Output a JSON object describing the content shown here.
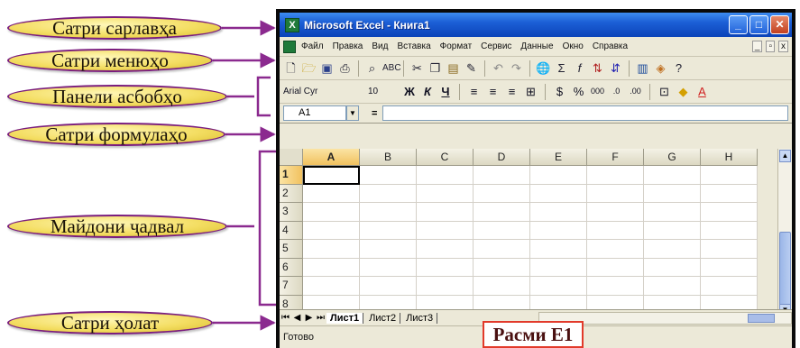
{
  "callouts": [
    "Сатри сарлавҳа",
    "Сатри менюҳо",
    "Панели асбобҳо",
    "Сатри формулаҳо",
    "Майдони ҷадвал",
    "Сатри ҳолат"
  ],
  "window": {
    "title": "Microsoft Excel - Книга1",
    "buttons": {
      "minimize": "_",
      "maximize": "□",
      "close": "✕"
    }
  },
  "menu": {
    "items": [
      "Файл",
      "Правка",
      "Вид",
      "Вставка",
      "Формат",
      "Сервис",
      "Данные",
      "Окно",
      "Справка"
    ],
    "doc_controls": [
      "_",
      "▫",
      "x"
    ]
  },
  "toolbar": {
    "icons": [
      "new-icon",
      "open-icon",
      "save-icon",
      "print-icon",
      "print-preview-icon",
      "spelling-icon",
      "cut-icon",
      "copy-icon",
      "paste-icon",
      "format-painter-icon",
      "undo-icon",
      "redo-icon",
      "hyperlink-icon",
      "autosum-icon",
      "function-icon",
      "sort-asc-icon",
      "sort-desc-icon",
      "chart-wizard-icon",
      "drawing-icon",
      "help-icon"
    ]
  },
  "format_bar": {
    "font_name": "Arial Cyr",
    "font_size": "10",
    "bold": "Ж",
    "italic": "К",
    "underline": "Ч"
  },
  "formula_bar": {
    "name_box": "A1",
    "equals": "="
  },
  "sheet": {
    "columns": [
      "A",
      "B",
      "C",
      "D",
      "E",
      "F",
      "G",
      "H"
    ],
    "rows": [
      "1",
      "2",
      "3",
      "4",
      "5",
      "6",
      "7",
      "8"
    ],
    "active_cell": "A1"
  },
  "tabs": [
    "Лист1",
    "Лист2",
    "Лист3"
  ],
  "status": "Готово",
  "caption": "Расми Е1",
  "colors": {
    "callout_fill": "#f4de63",
    "callout_border": "#7a1d7e",
    "arrow": "#8b2a8f",
    "title_bar": "#1c5fd6",
    "caption_border": "#e23a2a"
  }
}
